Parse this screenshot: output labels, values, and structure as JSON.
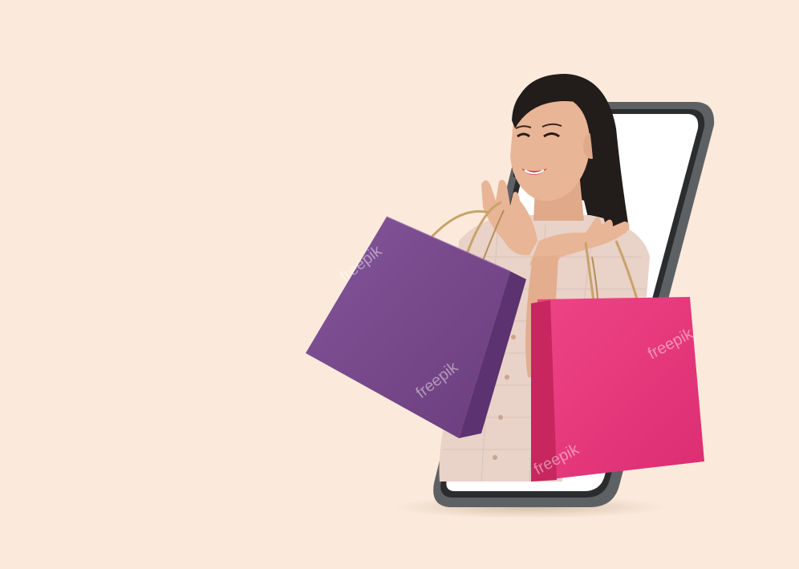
{
  "scene": {
    "background": "#fbeadb",
    "subject": "woman holding shopping bags emerging from smartphone",
    "colors": {
      "phone_frame": "#5e6164",
      "phone_screen": "#ffffff",
      "bag_purple": "#7a4a8e",
      "bag_pink": "#e7357a",
      "hair": "#221c1b",
      "skin": "#e8b596",
      "blouse": "#e9d2c8"
    },
    "icons": [
      "phone",
      "purple-shopping-bag",
      "pink-shopping-bag",
      "freepik-watermark"
    ]
  },
  "watermarks": [
    "freepik",
    "freepik",
    "freepik",
    "freepik"
  ]
}
